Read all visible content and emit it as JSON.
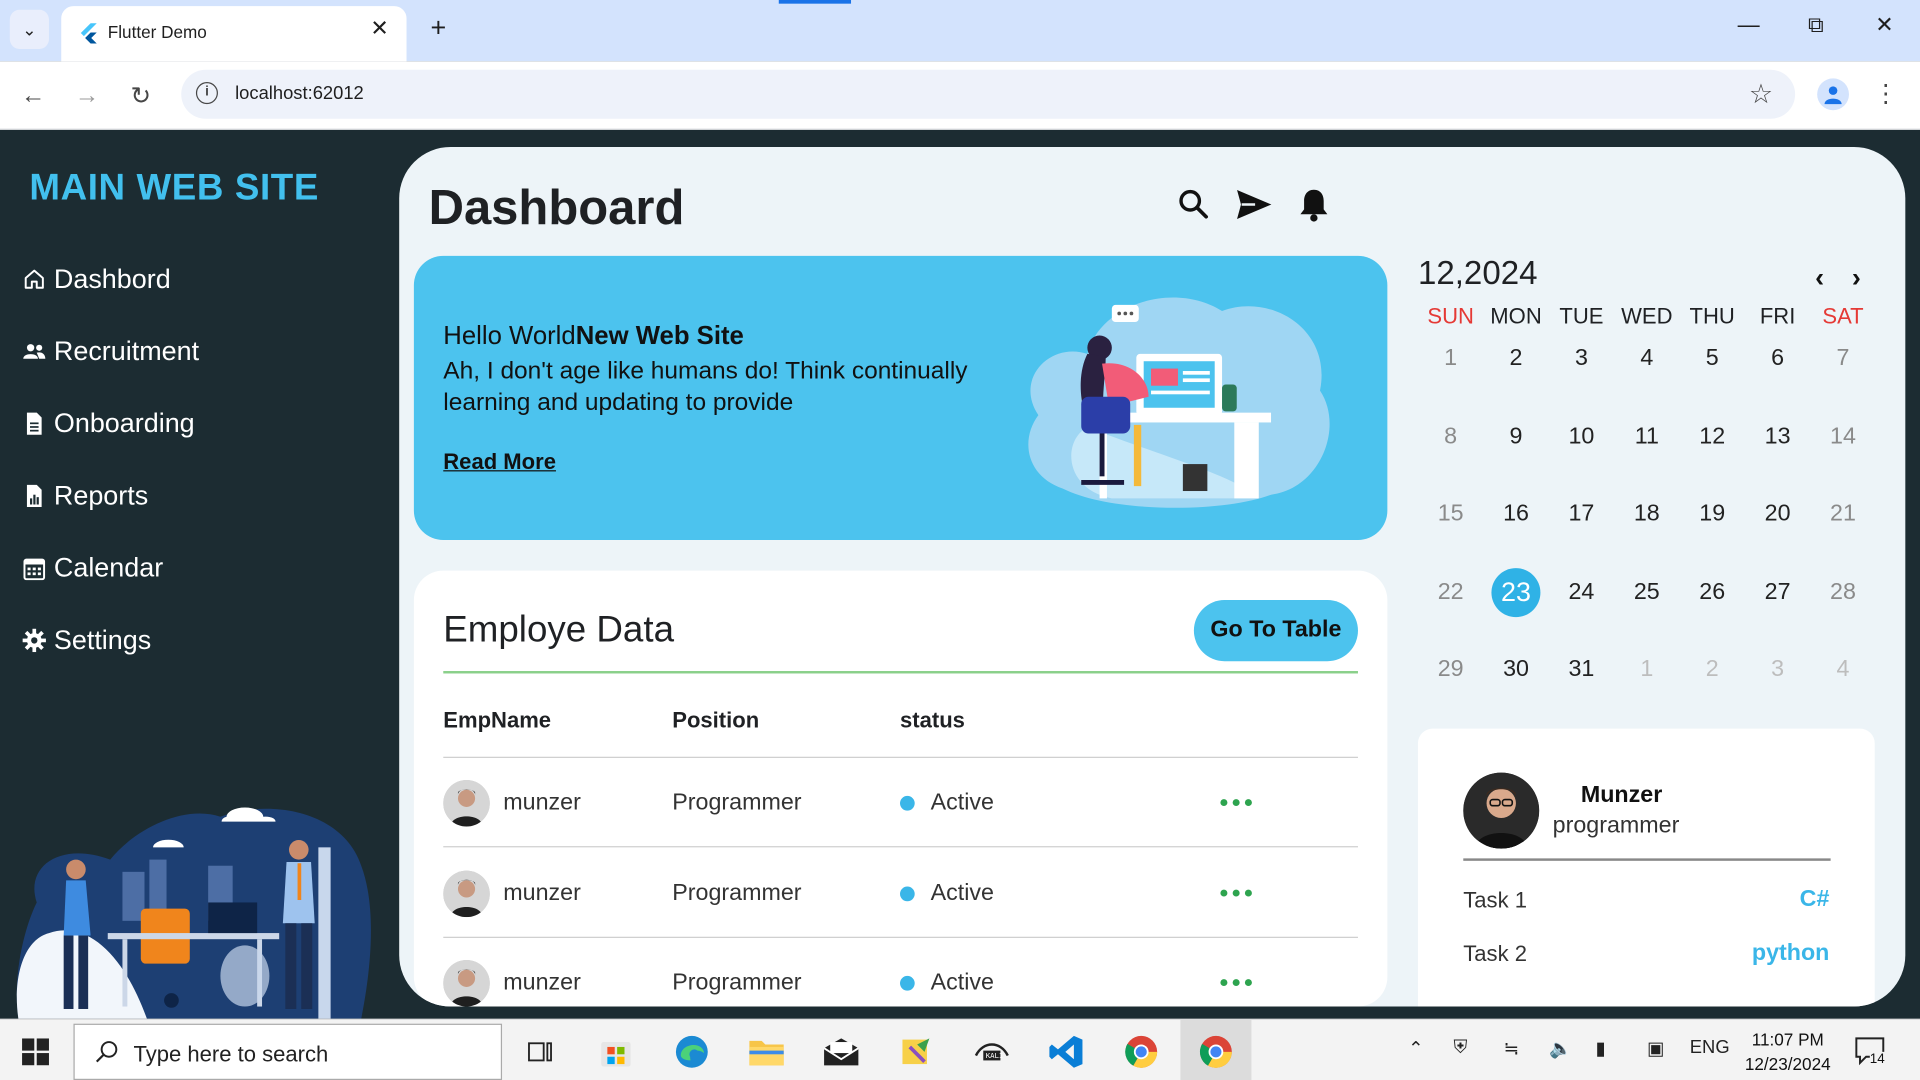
{
  "browser": {
    "tab_title": "Flutter Demo",
    "url": "localhost:62012"
  },
  "sidebar": {
    "brand": "MAIN WEB SITE",
    "items": [
      {
        "label": "Dashbord",
        "icon": "home-icon"
      },
      {
        "label": "Recruitment",
        "icon": "users-icon"
      },
      {
        "label": "Onboarding",
        "icon": "document-icon"
      },
      {
        "label": "Reports",
        "icon": "report-icon"
      },
      {
        "label": "Calendar",
        "icon": "calendar-icon"
      },
      {
        "label": "Settings",
        "icon": "gear-icon"
      }
    ]
  },
  "header": {
    "title": "Dashboard"
  },
  "banner": {
    "greeting": "Hello World",
    "highlight": "New Web Site",
    "text": "Ah, I don't age like humans do! Think continually learning and updating to provide",
    "link": "Read More",
    "color": "#4cc3ee"
  },
  "employees": {
    "title": "Employe Data",
    "button": "Go To Table",
    "columns": [
      "EmpName",
      "Position",
      "status"
    ],
    "rows": [
      {
        "name": "munzer",
        "position": "Programmer",
        "status": "Active"
      },
      {
        "name": "munzer",
        "position": "Programmer",
        "status": "Active"
      },
      {
        "name": "munzer",
        "position": "Programmer",
        "status": "Active"
      }
    ]
  },
  "calendar": {
    "title": "12,2024",
    "weekdays": [
      "SUN",
      "MON",
      "TUE",
      "WED",
      "THU",
      "FRI",
      "SAT"
    ],
    "weeks": [
      [
        "1",
        "2",
        "3",
        "4",
        "5",
        "6",
        "7"
      ],
      [
        "8",
        "9",
        "10",
        "11",
        "12",
        "13",
        "14"
      ],
      [
        "15",
        "16",
        "17",
        "18",
        "19",
        "20",
        "21"
      ],
      [
        "22",
        "23",
        "24",
        "25",
        "26",
        "27",
        "28"
      ],
      [
        "29",
        "30",
        "31",
        "1",
        "2",
        "3",
        "4"
      ]
    ],
    "today": "23"
  },
  "profile": {
    "name": "Munzer",
    "role": "programmer",
    "tasks": [
      {
        "label": "Task 1",
        "value": "C#"
      },
      {
        "label": "Task 2",
        "value": "python"
      }
    ]
  },
  "taskbar": {
    "search_placeholder": "Type here to search",
    "language": "ENG",
    "time": "11:07 PM",
    "date": "12/23/2024",
    "notifications": "14"
  }
}
